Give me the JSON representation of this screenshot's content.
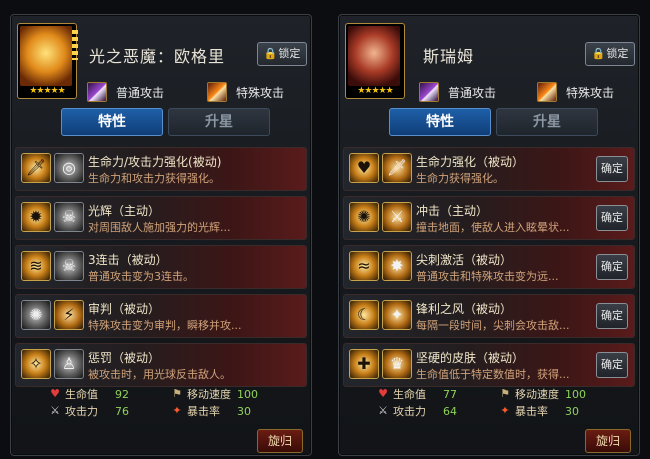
{
  "panels": [
    {
      "name": "光之恶魔：欧格里",
      "stars": "★★★★★",
      "lock_label": "锁定",
      "attack_normal": "普通攻击",
      "attack_special": "特殊攻击",
      "tab_traits": "特性",
      "tab_star_up": "升星",
      "skills": [
        {
          "title": "生命力/攻击力强化(被动)",
          "desc": "生命力和攻击力获得强化。",
          "icon_a": "sword-up-icon",
          "icon_b": "target-icon"
        },
        {
          "title": "光辉（主动）",
          "desc": "对周围敌人施加强力的光辉...",
          "icon_a": "sunburst-icon",
          "icon_b": "demon-face-icon"
        },
        {
          "title": "3连击（被动）",
          "desc": "普通攻击变为3连击。",
          "icon_a": "triple-slash-icon",
          "icon_b": "skull-icon"
        },
        {
          "title": "审判（被动）",
          "desc": "特殊攻击变为审判，瞬移并攻...",
          "icon_a": "judgment-icon",
          "icon_b": "beast-icon"
        },
        {
          "title": "惩罚（被动）",
          "desc": "被攻击时，用光球反击敌人。",
          "icon_a": "light-orb-icon",
          "icon_b": "figure-icon"
        }
      ],
      "stats": {
        "hp_label": "生命值",
        "hp": "92",
        "move_label": "移动速度",
        "move": "100",
        "atk_label": "攻击力",
        "atk": "76",
        "crit_label": "暴击率",
        "crit": "30"
      },
      "revert_label": "旋归"
    },
    {
      "name": "斯瑞姆",
      "stars": "★★★★★",
      "lock_label": "锁定",
      "attack_normal": "普通攻击",
      "attack_special": "特殊攻击",
      "tab_traits": "特性",
      "tab_star_up": "升星",
      "confirm_label": "确定",
      "skills": [
        {
          "title": "生命力强化（被动）",
          "desc": "生命力获得强化。",
          "icon_a": "heart-figure-icon",
          "icon_b": "sword-up-icon"
        },
        {
          "title": "冲击（主动）",
          "desc": "撞击地面，使敌人进入眩晕状...",
          "icon_a": "fire-impact-icon",
          "icon_b": "dragon-claw-icon"
        },
        {
          "title": "尖刺激活（被动）",
          "desc": "普通攻击和特殊攻击变为远...",
          "icon_a": "spike-wave-icon",
          "icon_b": "burst-icon"
        },
        {
          "title": "锋利之风（被动）",
          "desc": "每隔一段时间，尖刺会攻击敌...",
          "icon_a": "wind-blade-icon",
          "icon_b": "flame-ring-icon"
        },
        {
          "title": "坚硬的皮肤（被动）",
          "desc": "生命值低于特定数值时，获得...",
          "icon_a": "shield-cross-icon",
          "icon_b": "spike-crown-icon"
        }
      ],
      "stats": {
        "hp_label": "生命值",
        "hp": "77",
        "move_label": "移动速度",
        "move": "100",
        "atk_label": "攻击力",
        "atk": "64",
        "crit_label": "暴击率",
        "crit": "30"
      },
      "revert_label": "旋归"
    }
  ]
}
